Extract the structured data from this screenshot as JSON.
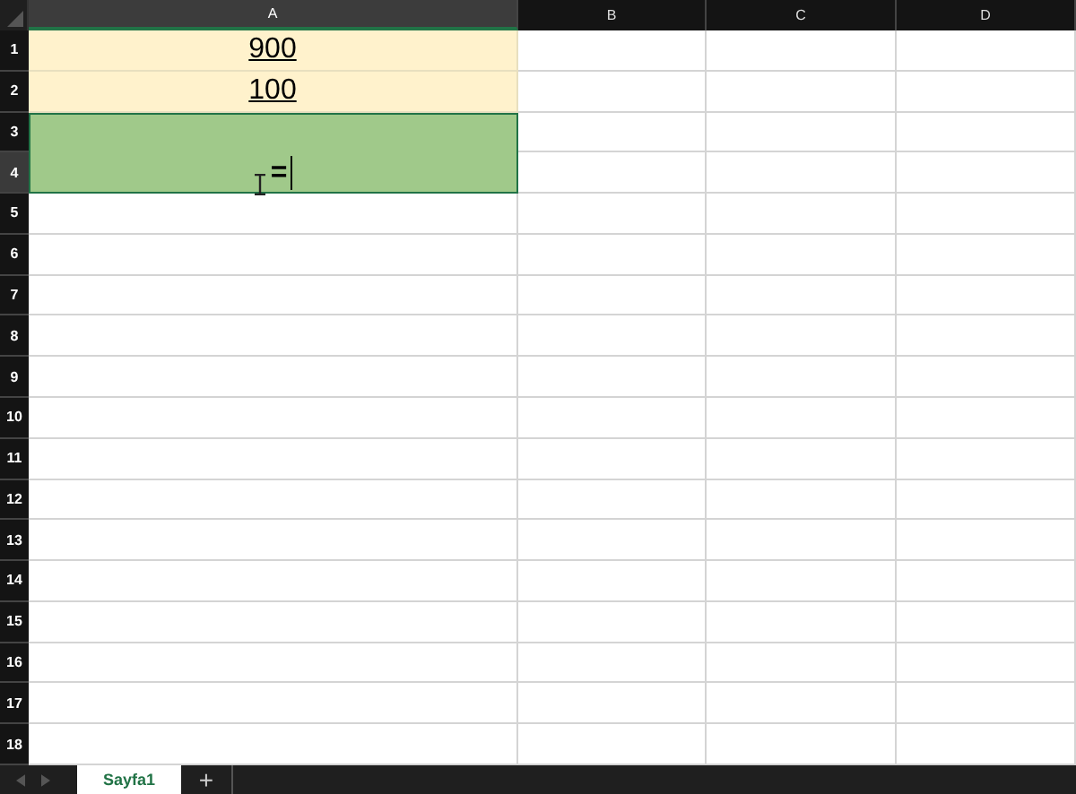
{
  "columns": [
    {
      "label": "A",
      "selected": true
    },
    {
      "label": "B",
      "selected": false
    },
    {
      "label": "C",
      "selected": false
    },
    {
      "label": "D",
      "selected": false
    }
  ],
  "rows": [
    {
      "label": "1",
      "selected": false
    },
    {
      "label": "2",
      "selected": false
    },
    {
      "label": "3",
      "selected": false
    },
    {
      "label": "4",
      "selected": true
    },
    {
      "label": "5",
      "selected": false
    },
    {
      "label": "6",
      "selected": false
    },
    {
      "label": "7",
      "selected": false
    },
    {
      "label": "8",
      "selected": false
    },
    {
      "label": "9",
      "selected": false
    },
    {
      "label": "10",
      "selected": false
    },
    {
      "label": "11",
      "selected": false
    },
    {
      "label": "12",
      "selected": false
    },
    {
      "label": "13",
      "selected": false
    },
    {
      "label": "14",
      "selected": false
    },
    {
      "label": "15",
      "selected": false
    },
    {
      "label": "16",
      "selected": false
    },
    {
      "label": "17",
      "selected": false
    },
    {
      "label": "18",
      "selected": false
    }
  ],
  "cells": [
    {
      "text": "900",
      "kind": "single",
      "color": "#fff2cc",
      "editing": false
    },
    {
      "text": "100",
      "kind": "single",
      "color": "#fff2cc",
      "editing": false
    },
    {
      "text": "=",
      "kind": "merged",
      "color": "#a0c98a",
      "editing": true
    }
  ],
  "sheet_tabs": [
    {
      "label": "Sayfa1",
      "selected": true
    }
  ],
  "add_sheet": "+"
}
